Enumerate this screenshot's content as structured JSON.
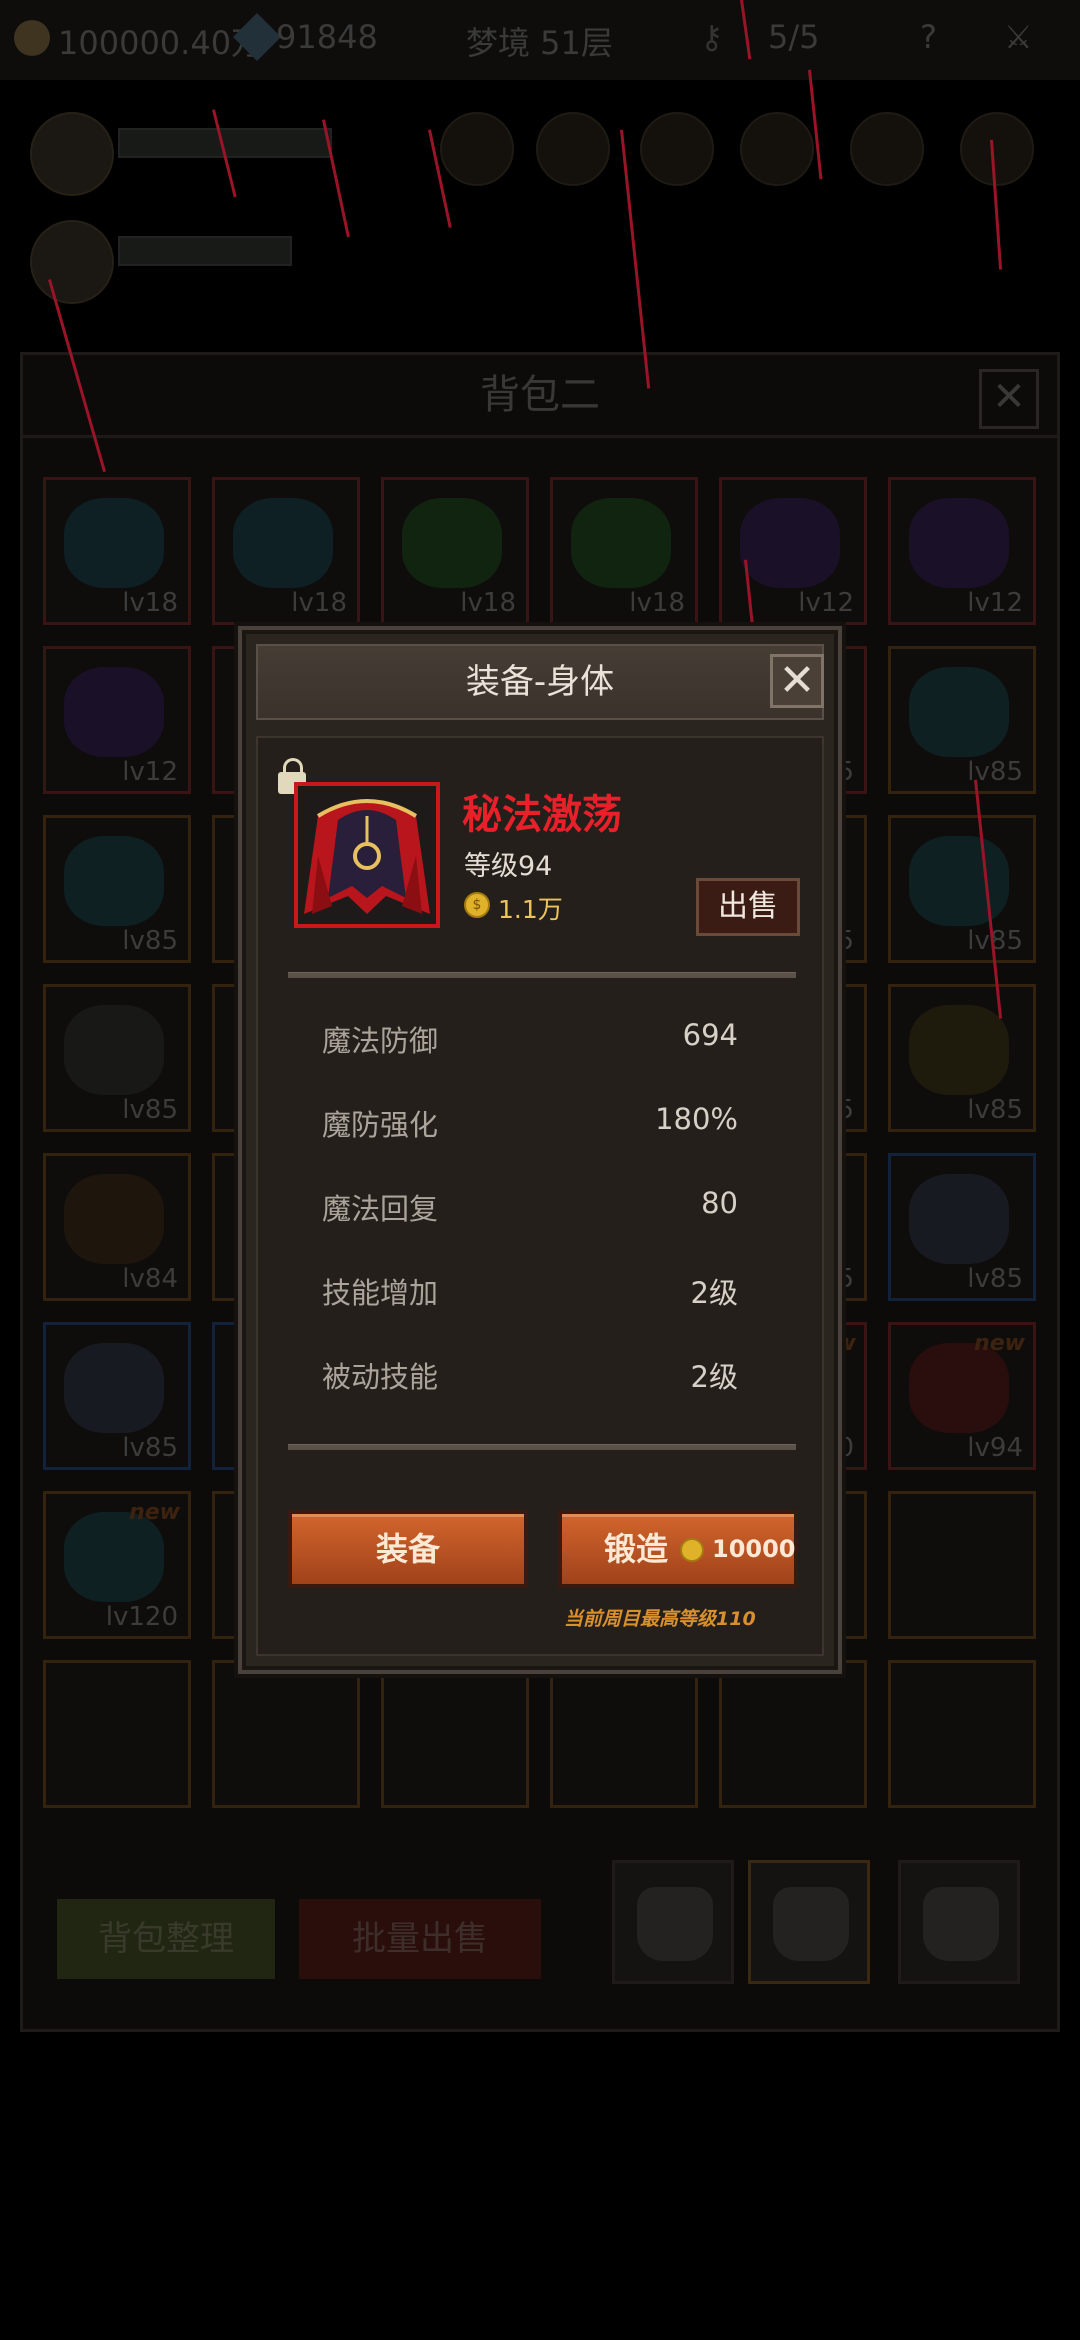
{
  "topbar": {
    "gold": "100000.40万",
    "gems": "91848",
    "stage": "梦境 51层",
    "keys": "5/5",
    "help_icon": "question-mark-icon",
    "settings_icon": "crossed-swords-icon"
  },
  "bag": {
    "title": "背包二",
    "close_label": "✕",
    "sort_button": "背包整理",
    "bulk_sell_button": "批量出售",
    "slots": [
      {
        "level": "lv18",
        "new": ""
      },
      {
        "level": "lv18",
        "new": ""
      },
      {
        "level": "lv18",
        "new": ""
      },
      {
        "level": "lv18",
        "new": ""
      },
      {
        "level": "lv12",
        "new": ""
      },
      {
        "level": "lv12",
        "new": ""
      },
      {
        "level": "lv12",
        "new": ""
      },
      {
        "level": "",
        "new": ""
      },
      {
        "level": "",
        "new": ""
      },
      {
        "level": "",
        "new": ""
      },
      {
        "level": "5",
        "new": ""
      },
      {
        "level": "lv85",
        "new": ""
      },
      {
        "level": "lv85",
        "new": ""
      },
      {
        "level": "",
        "new": ""
      },
      {
        "level": "",
        "new": ""
      },
      {
        "level": "",
        "new": ""
      },
      {
        "level": "5",
        "new": ""
      },
      {
        "level": "lv85",
        "new": ""
      },
      {
        "level": "lv85",
        "new": ""
      },
      {
        "level": "",
        "new": ""
      },
      {
        "level": "",
        "new": ""
      },
      {
        "level": "",
        "new": ""
      },
      {
        "level": "5",
        "new": ""
      },
      {
        "level": "lv85",
        "new": ""
      },
      {
        "level": "lv84",
        "new": ""
      },
      {
        "level": "",
        "new": ""
      },
      {
        "level": "",
        "new": ""
      },
      {
        "level": "",
        "new": ""
      },
      {
        "level": "5",
        "new": ""
      },
      {
        "level": "lv85",
        "new": ""
      },
      {
        "level": "lv85",
        "new": ""
      },
      {
        "level": "",
        "new": ""
      },
      {
        "level": "",
        "new": ""
      },
      {
        "level": "",
        "new": ""
      },
      {
        "level": "20",
        "new": "ew"
      },
      {
        "level": "lv94",
        "new": "new"
      },
      {
        "level": "lv120",
        "new": "new"
      },
      {
        "level": "",
        "new": ""
      },
      {
        "level": "",
        "new": ""
      },
      {
        "level": "",
        "new": ""
      },
      {
        "level": "",
        "new": ""
      },
      {
        "level": "",
        "new": ""
      },
      {
        "level": "",
        "new": ""
      },
      {
        "level": "",
        "new": ""
      },
      {
        "level": "",
        "new": ""
      },
      {
        "level": "",
        "new": ""
      },
      {
        "level": "",
        "new": ""
      },
      {
        "level": "",
        "new": ""
      }
    ]
  },
  "dialog": {
    "title": "装备-身体",
    "close_label": "✕",
    "item": {
      "name": "秘法激荡",
      "level": "等级94",
      "price": "1.1万",
      "gold_symbol": "$",
      "sell_label": "出售",
      "icon": "red-cloak-icon"
    },
    "stats": [
      {
        "name": "魔法防御",
        "value": "694"
      },
      {
        "name": "魔防强化",
        "value": "180%"
      },
      {
        "name": "魔法回复",
        "value": "80"
      },
      {
        "name": "技能增加",
        "value": "2级"
      },
      {
        "name": "被动技能",
        "value": "2级"
      }
    ],
    "equip_button": "装备",
    "forge_button": "锻造",
    "forge_cost": "10000",
    "note": "当前周目最高等级110"
  },
  "colors": {
    "rarity_red": "#c8181c",
    "item_name": "#e8202a",
    "button_orange": "#c05a26",
    "gold": "#e0b22a",
    "note": "#d8902c"
  }
}
